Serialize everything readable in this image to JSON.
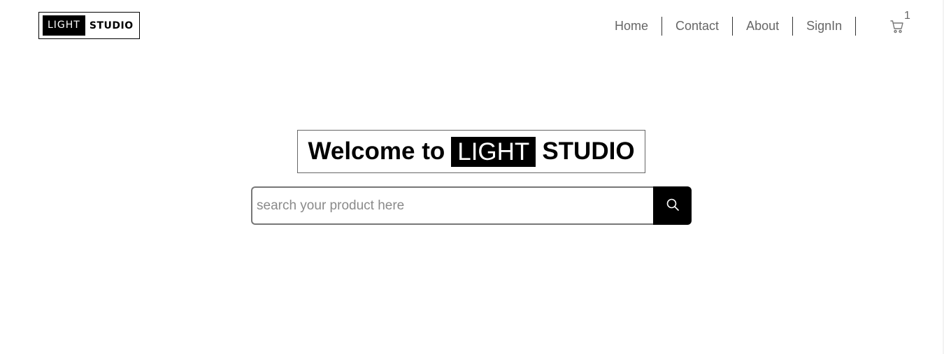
{
  "header": {
    "logo": {
      "highlight": "LIGHT",
      "word": "STUDIO"
    },
    "nav": [
      {
        "label": "Home"
      },
      {
        "label": "Contact"
      },
      {
        "label": "About"
      },
      {
        "label": "SignIn"
      }
    ],
    "cart": {
      "icon": "cart-icon",
      "count": "1"
    }
  },
  "hero": {
    "title_prefix": "Welcome to",
    "title_highlight": "LIGHT",
    "title_suffix": "STUDIO"
  },
  "search": {
    "placeholder": "search your product here",
    "value": "",
    "button_icon": "search-icon"
  },
  "colors": {
    "brand": "#000000",
    "nav_text": "#666666",
    "background": "#ffffff"
  }
}
